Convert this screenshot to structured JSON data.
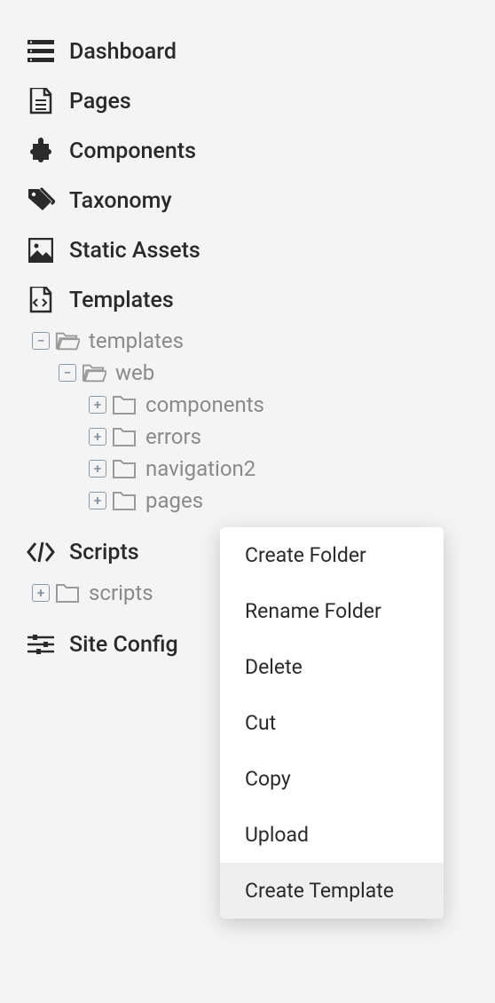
{
  "nav": {
    "dashboard": "Dashboard",
    "pages": "Pages",
    "components": "Components",
    "taxonomy": "Taxonomy",
    "static_assets": "Static Assets",
    "templates": "Templates",
    "scripts": "Scripts",
    "site_config": "Site Config"
  },
  "tree": {
    "templates_root": "templates",
    "web": "web",
    "components": "components",
    "errors": "errors",
    "navigation2": "navigation2",
    "pages": "pages",
    "scripts_root": "scripts"
  },
  "context_menu": {
    "create_folder": "Create Folder",
    "rename_folder": "Rename Folder",
    "delete": "Delete",
    "cut": "Cut",
    "copy": "Copy",
    "upload": "Upload",
    "create_template": "Create Template"
  }
}
